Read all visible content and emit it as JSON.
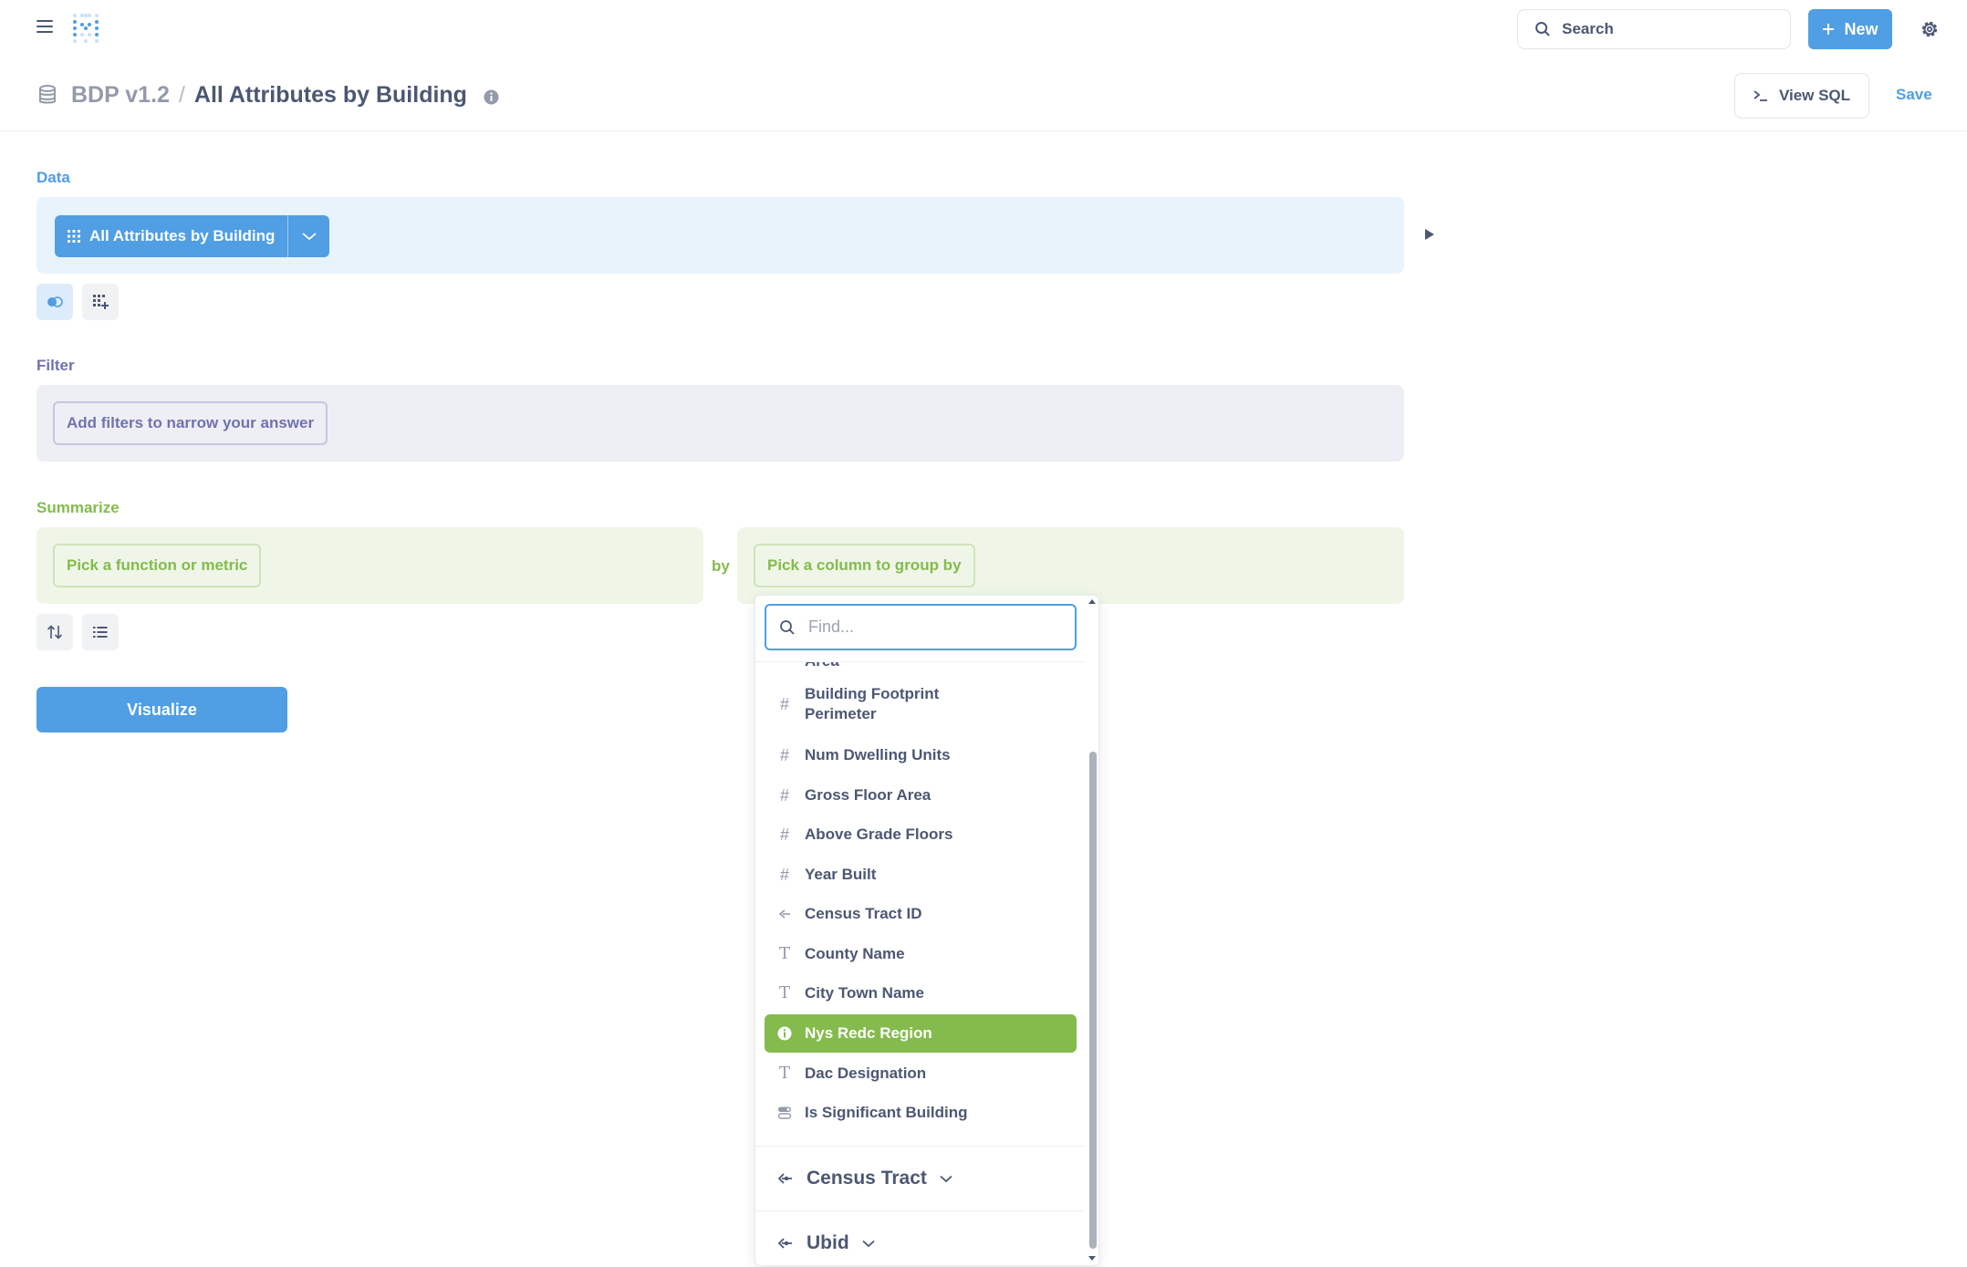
{
  "colors": {
    "brand": "#509ee3",
    "filter": "#7172ad",
    "summarize": "#84bb4c",
    "text": "#4c5773"
  },
  "nav": {
    "search_label": "Search",
    "new_label": "New"
  },
  "header": {
    "database": "BDP v1.2",
    "separator": "/",
    "title": "All Attributes by Building",
    "view_sql": "View SQL",
    "save": "Save"
  },
  "data_step": {
    "label": "Data",
    "table": "All Attributes by Building"
  },
  "filter_step": {
    "label": "Filter",
    "placeholder": "Add filters to narrow your answer"
  },
  "summarize_step": {
    "label": "Summarize",
    "metric_placeholder": "Pick a function or metric",
    "by": "by",
    "group_placeholder": "Pick a column to group by"
  },
  "visualize": "Visualize",
  "popover": {
    "find_placeholder": "Find...",
    "partial_item": "Area",
    "items": [
      {
        "label": "Building Footprint Perimeter",
        "icon": "number-icon"
      },
      {
        "label": "Num Dwelling Units",
        "icon": "number-icon"
      },
      {
        "label": "Gross Floor Area",
        "icon": "number-icon"
      },
      {
        "label": "Above Grade Floors",
        "icon": "number-icon"
      },
      {
        "label": "Year Built",
        "icon": "number-icon"
      },
      {
        "label": "Census Tract ID",
        "icon": "foreign-key-icon"
      },
      {
        "label": "County Name",
        "icon": "text-icon"
      },
      {
        "label": "City Town Name",
        "icon": "text-icon"
      },
      {
        "label": "Nys Redc Region",
        "icon": "info-icon",
        "selected": true
      },
      {
        "label": "Dac Designation",
        "icon": "text-icon"
      },
      {
        "label": "Is Significant Building",
        "icon": "toggle-icon"
      }
    ],
    "groups": [
      {
        "label": "Census Tract",
        "icon": "connections-icon"
      },
      {
        "label": "Ubid",
        "icon": "connections-icon"
      }
    ]
  }
}
